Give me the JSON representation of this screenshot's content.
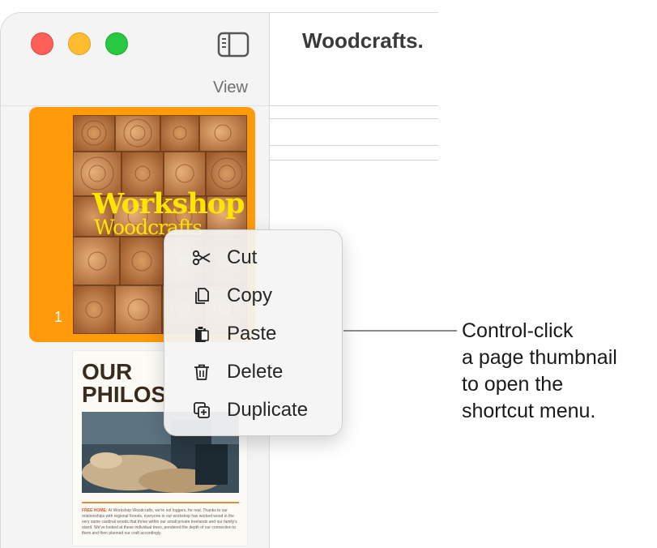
{
  "window": {
    "document_title": "Woodcrafts.",
    "view_label": "View"
  },
  "thumbnails": [
    {
      "page_number": "1",
      "title": "Workshop",
      "subtitle": "Woodcrafts",
      "selected": true
    },
    {
      "page_number": "",
      "title_line1": "OUR",
      "title_line2": "PHILOS",
      "body_lead": "FREE HOME:",
      "body_text": "At Workshop Woodcrafts, we're not loggers, for real. Thanks to our relationships with regional forests, everyone in our workshop has worked wood in the very same cardinal woods that thrive within our small private treelands and our family's stand. We've looked at these individual trees, pondered the depth of our connection to them and then planned our craft accordingly."
    }
  ],
  "context_menu": {
    "items": [
      {
        "label": "Cut",
        "icon": "scissors-icon"
      },
      {
        "label": "Copy",
        "icon": "copy-icon"
      },
      {
        "label": "Paste",
        "icon": "paste-icon"
      },
      {
        "label": "Delete",
        "icon": "trash-icon"
      },
      {
        "label": "Duplicate",
        "icon": "duplicate-icon"
      }
    ]
  },
  "callout": {
    "line1": "Control-click",
    "line2": "a page thumbnail",
    "line3": "to open the",
    "line4": "shortcut menu."
  },
  "colors": {
    "selection": "#ff9a0a",
    "cover_text": "#ffe600",
    "close": "#fe5f57",
    "minimize": "#febc2e",
    "zoom": "#28c840"
  }
}
